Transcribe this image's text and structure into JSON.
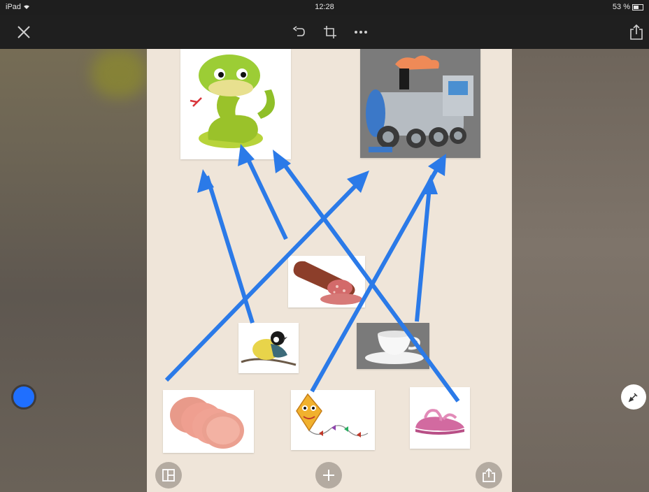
{
  "status_bar": {
    "carrier": "iPad",
    "time": "12:28",
    "battery": "53 %"
  },
  "toolbar": {
    "close_icon": "close-icon",
    "undo_icon": "undo-icon",
    "crop_icon": "crop-icon",
    "more_icon": "more-icon",
    "share_icon": "share-icon"
  },
  "board": {
    "background": "#efe5d9",
    "arrow_color": "#2b7ae8",
    "cards": [
      "snake",
      "steam-locomotive",
      "salami-sausage",
      "bird",
      "teacup",
      "sliced-sausage",
      "kite",
      "sandal"
    ]
  },
  "side_controls": {
    "color_swatch": "#1f6fff",
    "pen_icon": "pen-icon"
  },
  "bottom_bar": {
    "layout_icon": "layout-icon",
    "add_icon": "plus-icon",
    "export_icon": "share-icon"
  }
}
